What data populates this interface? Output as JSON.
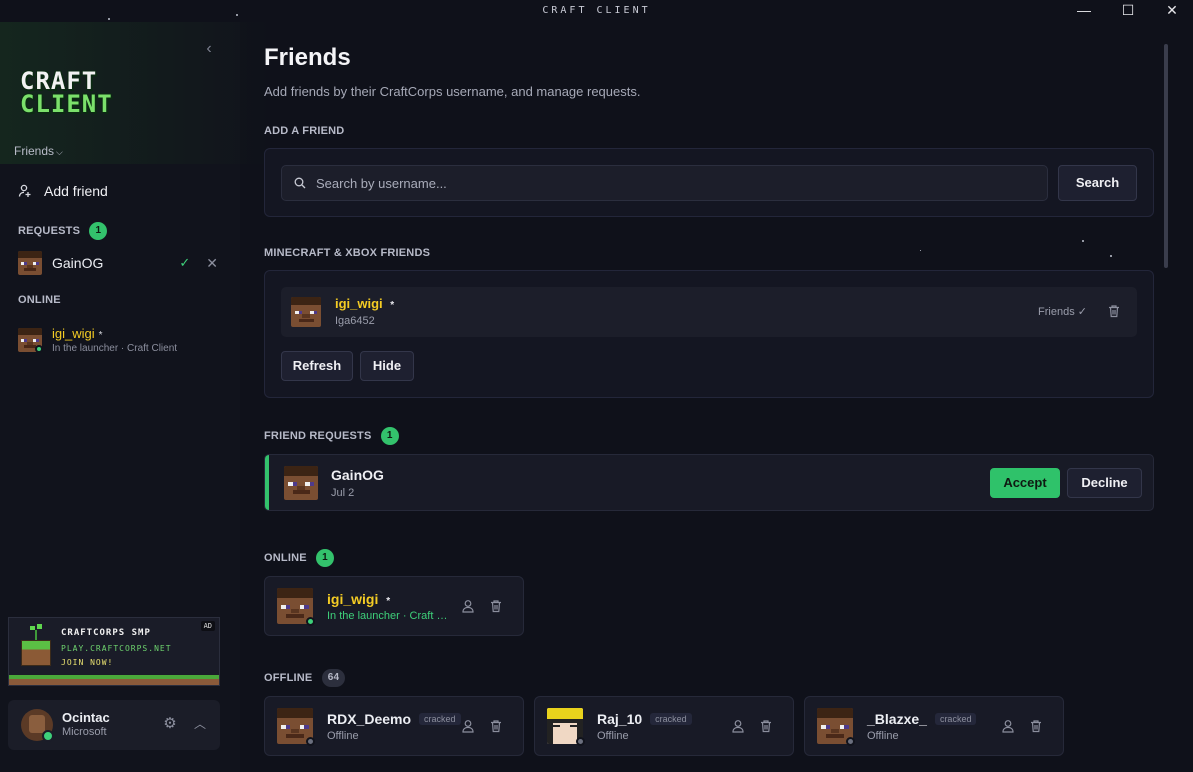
{
  "window": {
    "title": "CRAFT CLIENT",
    "minimize": "—",
    "maximize": "☐",
    "close": "✕"
  },
  "sidebar": {
    "logo_line1": "CRAFT",
    "logo_line2": "CLIENT",
    "collapse": "‹",
    "dropdown_label": "Friends",
    "add_friend": "Add friend",
    "requests_label": "REQUESTS",
    "requests_count": "1",
    "request": {
      "name": "GainOG",
      "accept": "✓",
      "decline": "✕"
    },
    "online_label": "ONLINE",
    "online_friend": {
      "name": "igi_wigi",
      "mark": "*",
      "status": "In the launcher · Craft Client"
    }
  },
  "ad": {
    "tag": "AD",
    "line1": "CRAFTCORPS SMP",
    "line2": "PLAY.CRAFTCORPS.NET",
    "line3": "JOIN NOW!"
  },
  "account": {
    "name": "Ocintac",
    "provider": "Microsoft",
    "settings_icon": "⚙",
    "expand_icon": "︿"
  },
  "main": {
    "title": "Friends",
    "subtitle": "Add friends by their CraftCorps username, and manage requests.",
    "add_section": "ADD A FRIEND",
    "search_placeholder": "Search by username...",
    "search_button": "Search",
    "mc_section": "MINECRAFT & XBOX FRIENDS",
    "mc_friend": {
      "name": "igi_wigi",
      "mark": "*",
      "gamertag": "Iga6452",
      "state": "Friends ✓"
    },
    "refresh": "Refresh",
    "hide": "Hide",
    "requests_section": "FRIEND REQUESTS",
    "requests_count": "1",
    "request": {
      "name": "GainOG",
      "date": "Jul 2",
      "accept": "Accept",
      "decline": "Decline"
    },
    "online_section": "ONLINE",
    "online_count": "1",
    "online": [
      {
        "name": "igi_wigi",
        "mark": "*",
        "status": "In the launcher · Craft Client"
      }
    ],
    "offline_section": "OFFLINE",
    "offline_count": "64",
    "offline": [
      {
        "name": "RDX_Deemo",
        "tag": "cracked",
        "status": "Offline"
      },
      {
        "name": "Raj_10",
        "tag": "cracked",
        "status": "Offline"
      },
      {
        "name": "_Blazxe_",
        "tag": "cracked",
        "status": "Offline"
      }
    ]
  },
  "colors": {
    "accent_green": "#33c26c",
    "gold_name": "#f4cc24",
    "background": "#0f111a"
  }
}
